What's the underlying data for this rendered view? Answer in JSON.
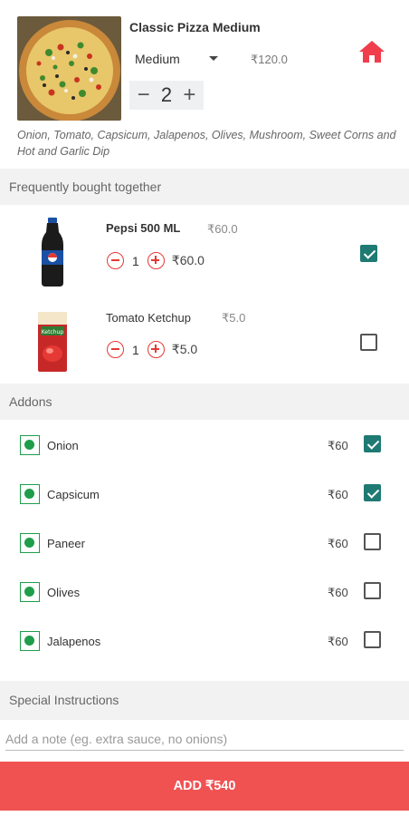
{
  "product": {
    "name": "Classic Pizza Medium",
    "size": "Medium",
    "price": "₹120.0",
    "quantity": "2",
    "minus_symbol": "−",
    "plus_symbol": "+",
    "toppings": "Onion, Tomato, Capsicum, Jalapenos, Olives, Mushroom,  Sweet Corns and Hot and Garlic Dip",
    "image_icon": "pizza-photo",
    "home_icon": "home-icon",
    "accent_color": "#f03e4c"
  },
  "frequently_bought": {
    "title": "Frequently bought together",
    "items": [
      {
        "name": "Pepsi 500 ML",
        "unit_price": "₹60.0",
        "quantity": "1",
        "total": "₹60.0",
        "checked": true,
        "image_icon": "pepsi-bottle"
      },
      {
        "name": "Tomato Ketchup",
        "unit_price": "₹5.0",
        "quantity": "1",
        "total": "₹5.0",
        "checked": false,
        "image_icon": "ketchup-sachet"
      }
    ]
  },
  "addons": {
    "title": "Addons",
    "items": [
      {
        "name": "Onion",
        "price": "₹60",
        "checked": true
      },
      {
        "name": "Capsicum",
        "price": "₹60",
        "checked": true
      },
      {
        "name": "Paneer",
        "price": "₹60",
        "checked": false
      },
      {
        "name": "Olives",
        "price": "₹60",
        "checked": false
      },
      {
        "name": "Jalapenos",
        "price": "₹60",
        "checked": false
      }
    ]
  },
  "special_instructions": {
    "title": "Special Instructions",
    "placeholder": "Add a note (eg. extra sauce, no onions)"
  },
  "footer": {
    "add_label": "ADD ₹540",
    "button_color": "#f05252"
  },
  "colors": {
    "check_color": "#1f7a73",
    "veg_color": "#1e9e4a",
    "stepper_red": "#e53935"
  }
}
